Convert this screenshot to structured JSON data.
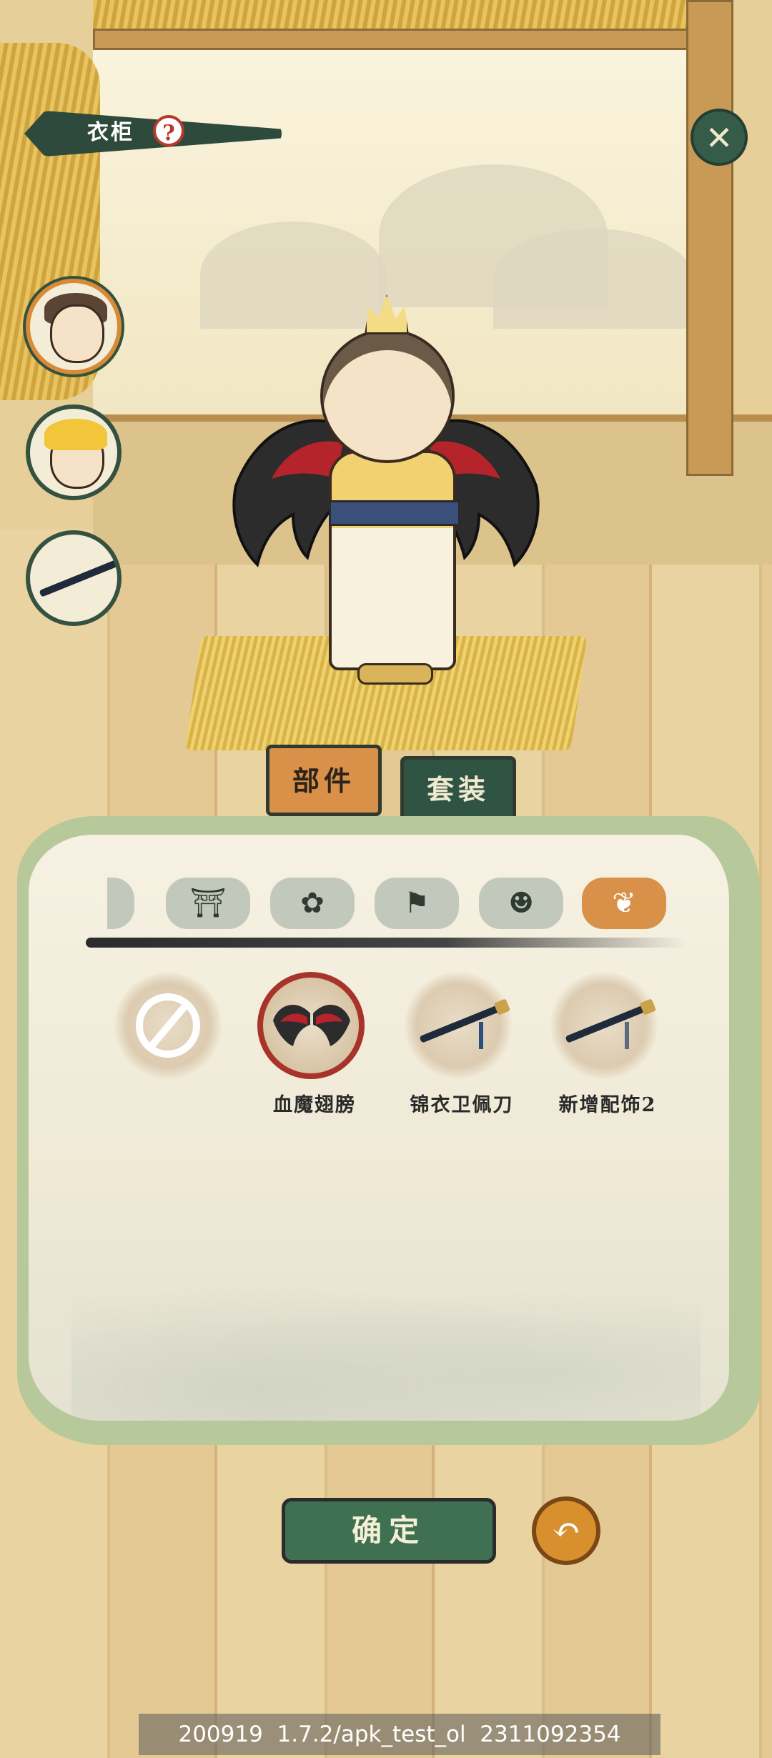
{
  "header": {
    "title": "衣柜",
    "help_icon": "question-mark-icon",
    "close_icon": "close-x-icon"
  },
  "avatars": [
    {
      "name": "character-avatar-1",
      "selected": true
    },
    {
      "name": "character-avatar-2",
      "selected": false
    },
    {
      "name": "weapon-avatar",
      "selected": false
    }
  ],
  "tabs": {
    "parts_label": "部件",
    "suits_label": "套装",
    "active": "部件"
  },
  "categories": [
    {
      "icon": "partial-icon",
      "glyph": "◗"
    },
    {
      "icon": "robe-icon",
      "glyph": "⛩"
    },
    {
      "icon": "flower-icon",
      "glyph": "✿"
    },
    {
      "icon": "cloth-icon",
      "glyph": "⚑"
    },
    {
      "icon": "face-icon",
      "glyph": "☻"
    },
    {
      "icon": "wing-icon",
      "glyph": "❦",
      "selected": true
    }
  ],
  "items": [
    {
      "label": "",
      "type": "none"
    },
    {
      "label": "血魔翅膀",
      "type": "wings",
      "selected": true
    },
    {
      "label": "锦衣卫佩刀",
      "type": "sword"
    },
    {
      "label": "新增配饰2",
      "type": "sword"
    }
  ],
  "buttons": {
    "confirm_label": "确定",
    "undo_icon": "undo-arrow-icon",
    "undo_glyph": "↶",
    "close_glyph": "✕",
    "help_glyph": "?"
  },
  "version": "200919  1.7.2/apk_test_ol  2311092354",
  "colors": {
    "accent_orange": "#d9914a",
    "dark_green": "#2f5443",
    "panel_green": "#b7c89a",
    "wing_red": "#a8332a"
  }
}
